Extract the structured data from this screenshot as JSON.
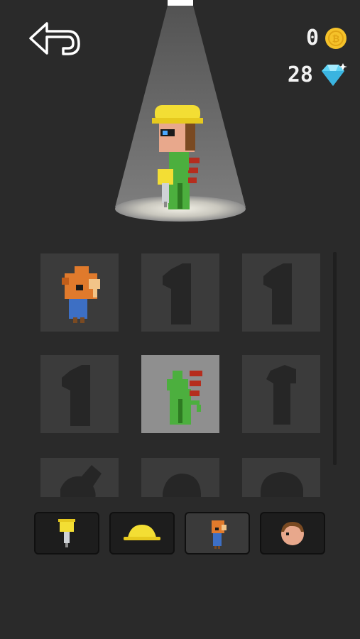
{
  "currency": {
    "coins": "0",
    "gems": "28"
  },
  "icons": {
    "back": "back-arrow-icon",
    "coin": "coin-icon",
    "gem": "diamond-icon"
  },
  "tabs": [
    {
      "name": "tool-tab",
      "icon": "jackhammer-icon"
    },
    {
      "name": "hat-tab",
      "icon": "hard-hat-icon"
    },
    {
      "name": "outfit-tab",
      "icon": "character-outfit-icon",
      "active": true
    },
    {
      "name": "head-tab",
      "icon": "head-icon"
    }
  ],
  "outfits": [
    {
      "name": "outfit-orange-creature",
      "unlocked": true
    },
    {
      "name": "outfit-locked-2",
      "unlocked": false
    },
    {
      "name": "outfit-locked-3",
      "unlocked": false
    },
    {
      "name": "outfit-locked-4",
      "unlocked": false
    },
    {
      "name": "outfit-green-dragon",
      "unlocked": true,
      "selected": true
    },
    {
      "name": "outfit-locked-6",
      "unlocked": false
    },
    {
      "name": "outfit-locked-7",
      "unlocked": false
    },
    {
      "name": "outfit-locked-8",
      "unlocked": false
    },
    {
      "name": "outfit-locked-9",
      "unlocked": false
    }
  ],
  "colors": {
    "background": "#2a2a2a",
    "cell": "#3b3b3b",
    "cell_selected": "#8f8f8f",
    "gem": "#5fd4f5",
    "coin": "#f5c22a"
  }
}
